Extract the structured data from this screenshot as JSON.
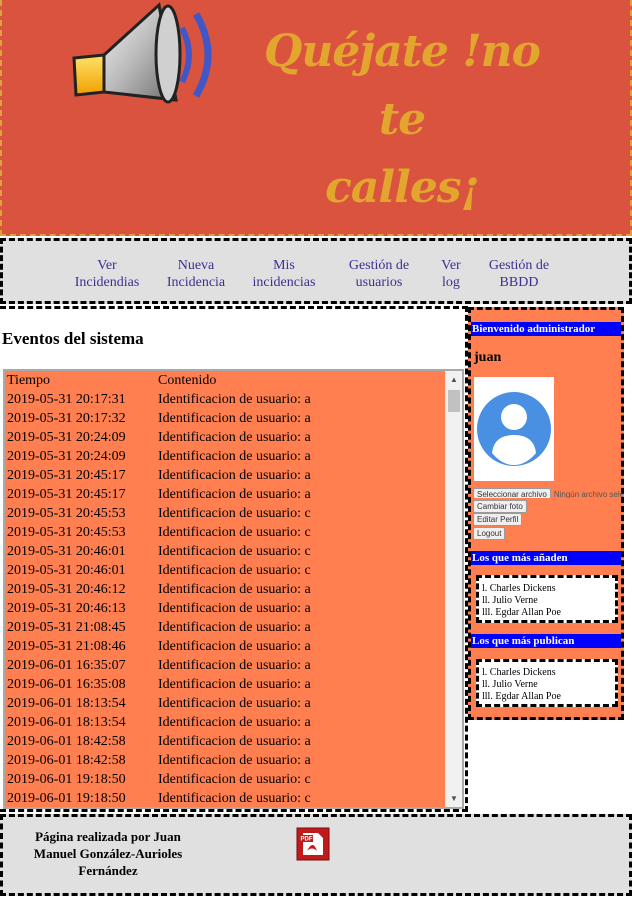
{
  "header": {
    "slogan_line1": "Quéjate !no te",
    "slogan_line2": "calles¡",
    "logo_icon": "megaphone-speaker-icon"
  },
  "nav": {
    "items": [
      {
        "line1": "Ver",
        "line2": "Incidendias"
      },
      {
        "line1": "Nueva",
        "line2": "Incidencia"
      },
      {
        "line1": "Mis",
        "line2": "incidencias"
      },
      {
        "line1": "Gestión de",
        "line2": "usuarios"
      },
      {
        "line1": "Ver",
        "line2": "log"
      },
      {
        "line1": "Gestión de",
        "line2": "BBDD"
      }
    ]
  },
  "main": {
    "title": "Eventos del sistema",
    "columns": [
      "Tiempo",
      "Contenido"
    ],
    "rows": [
      [
        "2019-05-31 20:17:31",
        "Identificacion de usuario: a"
      ],
      [
        "2019-05-31 20:17:32",
        "Identificacion de usuario: a"
      ],
      [
        "2019-05-31 20:24:09",
        "Identificacion de usuario: a"
      ],
      [
        "2019-05-31 20:24:09",
        "Identificacion de usuario: a"
      ],
      [
        "2019-05-31 20:45:17",
        "Identificacion de usuario: a"
      ],
      [
        "2019-05-31 20:45:17",
        "Identificacion de usuario: a"
      ],
      [
        "2019-05-31 20:45:53",
        "Identificacion de usuario: c"
      ],
      [
        "2019-05-31 20:45:53",
        "Identificacion de usuario: c"
      ],
      [
        "2019-05-31 20:46:01",
        "Identificacion de usuario: c"
      ],
      [
        "2019-05-31 20:46:01",
        "Identificacion de usuario: c"
      ],
      [
        "2019-05-31 20:46:12",
        "Identificacion de usuario: a"
      ],
      [
        "2019-05-31 20:46:13",
        "Identificacion de usuario: a"
      ],
      [
        "2019-05-31 21:08:45",
        "Identificacion de usuario: a"
      ],
      [
        "2019-05-31 21:08:46",
        "Identificacion de usuario: a"
      ],
      [
        "2019-06-01 16:35:07",
        "Identificacion de usuario: a"
      ],
      [
        "2019-06-01 16:35:08",
        "Identificacion de usuario: a"
      ],
      [
        "2019-06-01 18:13:54",
        "Identificacion de usuario: a"
      ],
      [
        "2019-06-01 18:13:54",
        "Identificacion de usuario: a"
      ],
      [
        "2019-06-01 18:42:58",
        "Identificacion de usuario: a"
      ],
      [
        "2019-06-01 18:42:58",
        "Identificacion de usuario: a"
      ],
      [
        "2019-06-01 19:18:50",
        "Identificacion de usuario: c"
      ],
      [
        "2019-06-01 19:18:50",
        "Identificacion de usuario: c"
      ]
    ]
  },
  "sidebar": {
    "welcome": "Bienvenido administrador",
    "username": "juan",
    "avatar_icon": "user-avatar-icon",
    "file_button": "Seleccionar archivo",
    "file_status": "Ningún archivo seleccionado",
    "change_photo": "Cambiar foto",
    "edit_profile": "Editar Perfil",
    "logout": "Logout",
    "top_adders_title": "Los que más añaden",
    "top_adders": [
      "l. Charles Dickens",
      "ll. Julio Verne",
      "lll. Egdar Allan Poe"
    ],
    "top_publishers_title": "Los que más publican",
    "top_publishers": [
      "l. Charles Dickens",
      "ll. Julio Verne",
      "lll. Egdar Allan Poe"
    ]
  },
  "footer": {
    "credit": "Página realizada por Juan Manuel González-Aurioles Fernández",
    "pdf_icon": "pdf-document-icon"
  },
  "colors": {
    "header_bg": "#d9533e",
    "slogan": "#e2a52e",
    "panel_bg": "#ff7f50",
    "bar_blue": "#0000ff",
    "nav_bg": "#e0e0e0",
    "link": "#3d2f8f"
  }
}
